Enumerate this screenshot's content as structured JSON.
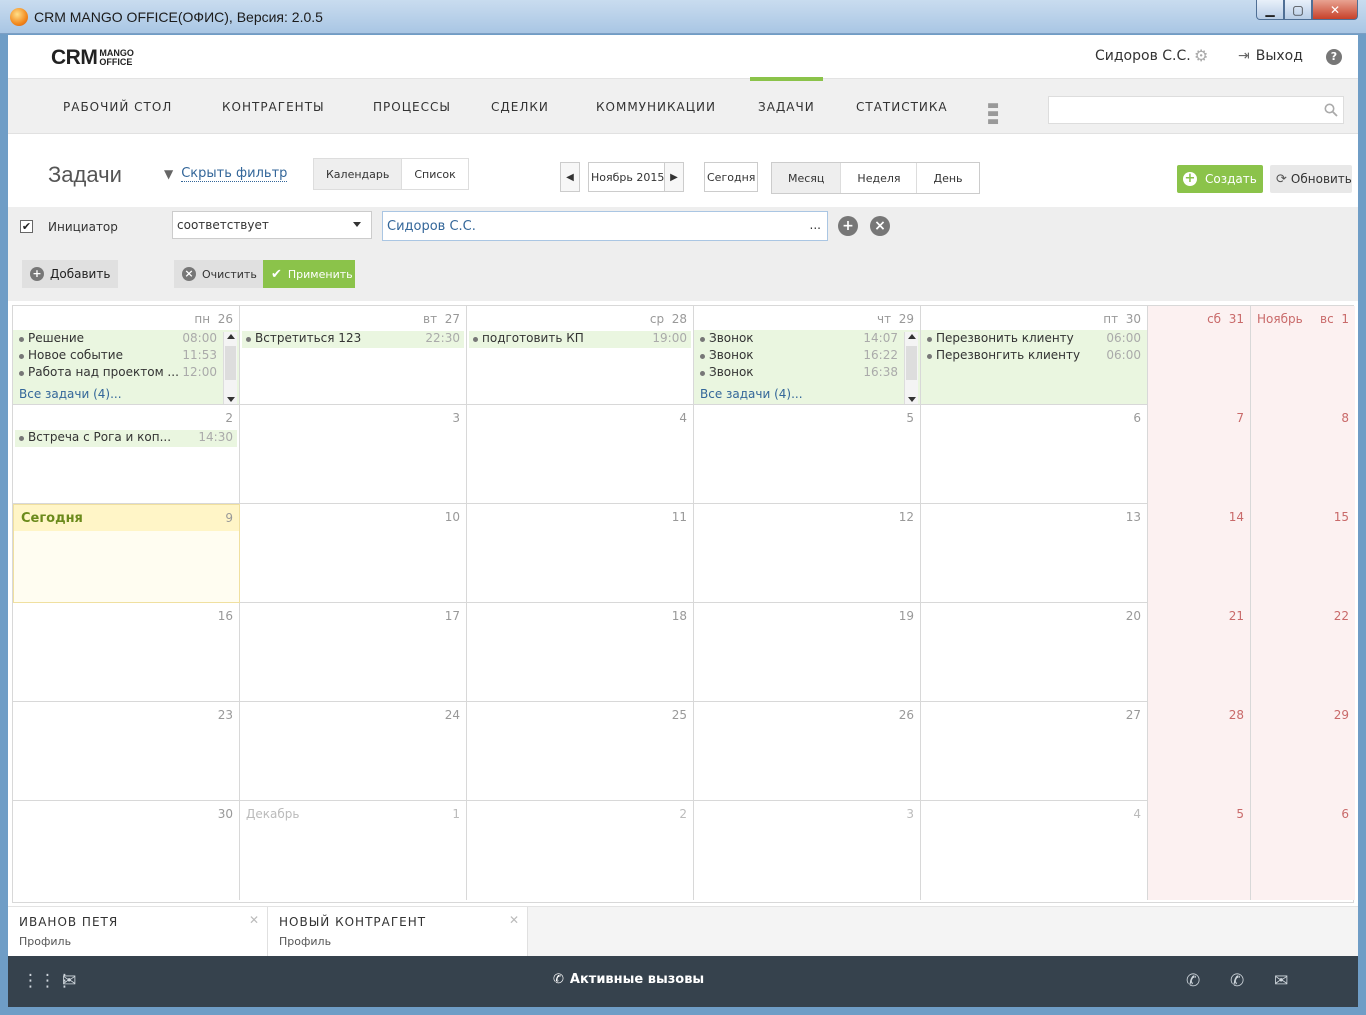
{
  "window": {
    "title": "CRM MANGO OFFICE(ОФИС), Версия: 2.0.5"
  },
  "header": {
    "logo_main": "CRM",
    "logo_sub1": "MANGO",
    "logo_sub2": "OFFICE",
    "user": "Сидоров С.С.",
    "logout": "Выход",
    "help": "?"
  },
  "nav": {
    "items": [
      "РАБОЧИЙ СТОЛ",
      "КОНТРАГЕНТЫ",
      "ПРОЦЕССЫ",
      "СДЕЛКИ",
      "КОММУНИКАЦИИ",
      "ЗАДАЧИ",
      "СТАТИСТИКА"
    ],
    "active": "ЗАДАЧИ",
    "search_value": ""
  },
  "toolbar": {
    "title": "Задачи",
    "hide_filter": "Скрыть фильтр",
    "view_calendar": "Календарь",
    "view_list": "Список",
    "period": "Ноябрь 2015",
    "today": "Сегодня",
    "range_month": "Месяц",
    "range_week": "Неделя",
    "range_day": "День",
    "create": "Создать",
    "refresh": "Обновить"
  },
  "filter": {
    "field": "Инициатор",
    "operator": "соответствует",
    "value": "Сидоров С.С.",
    "dots": "...",
    "add": "Добавить",
    "clear": "Очистить",
    "apply": "Применить"
  },
  "calendar": {
    "dow": [
      "пн",
      "вт",
      "ср",
      "чт",
      "пт",
      "сб",
      "вс"
    ],
    "nov_label": "Ноябрь",
    "dec_label": "Декабрь",
    "today_label": "Сегодня",
    "all_tasks": "Все задачи (4)...",
    "weeks": [
      [
        "26",
        "27",
        "28",
        "29",
        "30",
        "31",
        "1"
      ],
      [
        "2",
        "3",
        "4",
        "5",
        "6",
        "7",
        "8"
      ],
      [
        "9",
        "10",
        "11",
        "12",
        "13",
        "14",
        "15"
      ],
      [
        "16",
        "17",
        "18",
        "19",
        "20",
        "21",
        "22"
      ],
      [
        "23",
        "24",
        "25",
        "26",
        "27",
        "28",
        "29"
      ],
      [
        "30",
        "1",
        "2",
        "3",
        "4",
        "5",
        "6"
      ]
    ],
    "events": {
      "mon26": [
        {
          "title": "Решение",
          "time": "08:00"
        },
        {
          "title": "Новое событие",
          "time": "11:53"
        },
        {
          "title": "Работа над проектом ...",
          "time": "12:00"
        }
      ],
      "tue27": [
        {
          "title": "Встретиться 123",
          "time": "22:30"
        }
      ],
      "wed28": [
        {
          "title": "подготовить КП",
          "time": "19:00"
        }
      ],
      "thu29": [
        {
          "title": "Звонок",
          "time": "14:07"
        },
        {
          "title": "Звонок",
          "time": "16:22"
        },
        {
          "title": "Звонок",
          "time": "16:38"
        }
      ],
      "fri30": [
        {
          "title": "Перезвонить клиенту",
          "time": "06:00"
        },
        {
          "title": "Перезвонгить клиенту",
          "time": "06:00"
        }
      ],
      "mon2": [
        {
          "title": "Встреча с Рога и коп...",
          "time": "14:30"
        }
      ]
    }
  },
  "contacts": [
    {
      "name": "ИВАНОВ ПЕТЯ",
      "sub": "Профиль"
    },
    {
      "name": "НОВЫЙ КОНТРАГЕНТ",
      "sub": "Профиль"
    }
  ],
  "bottom": {
    "active_calls": "Активные вызовы"
  },
  "colors": {
    "accent_green": "#8bc34a",
    "link_blue": "#336699",
    "weekend": "#c96a6a",
    "bottom_bar": "#36424d"
  }
}
